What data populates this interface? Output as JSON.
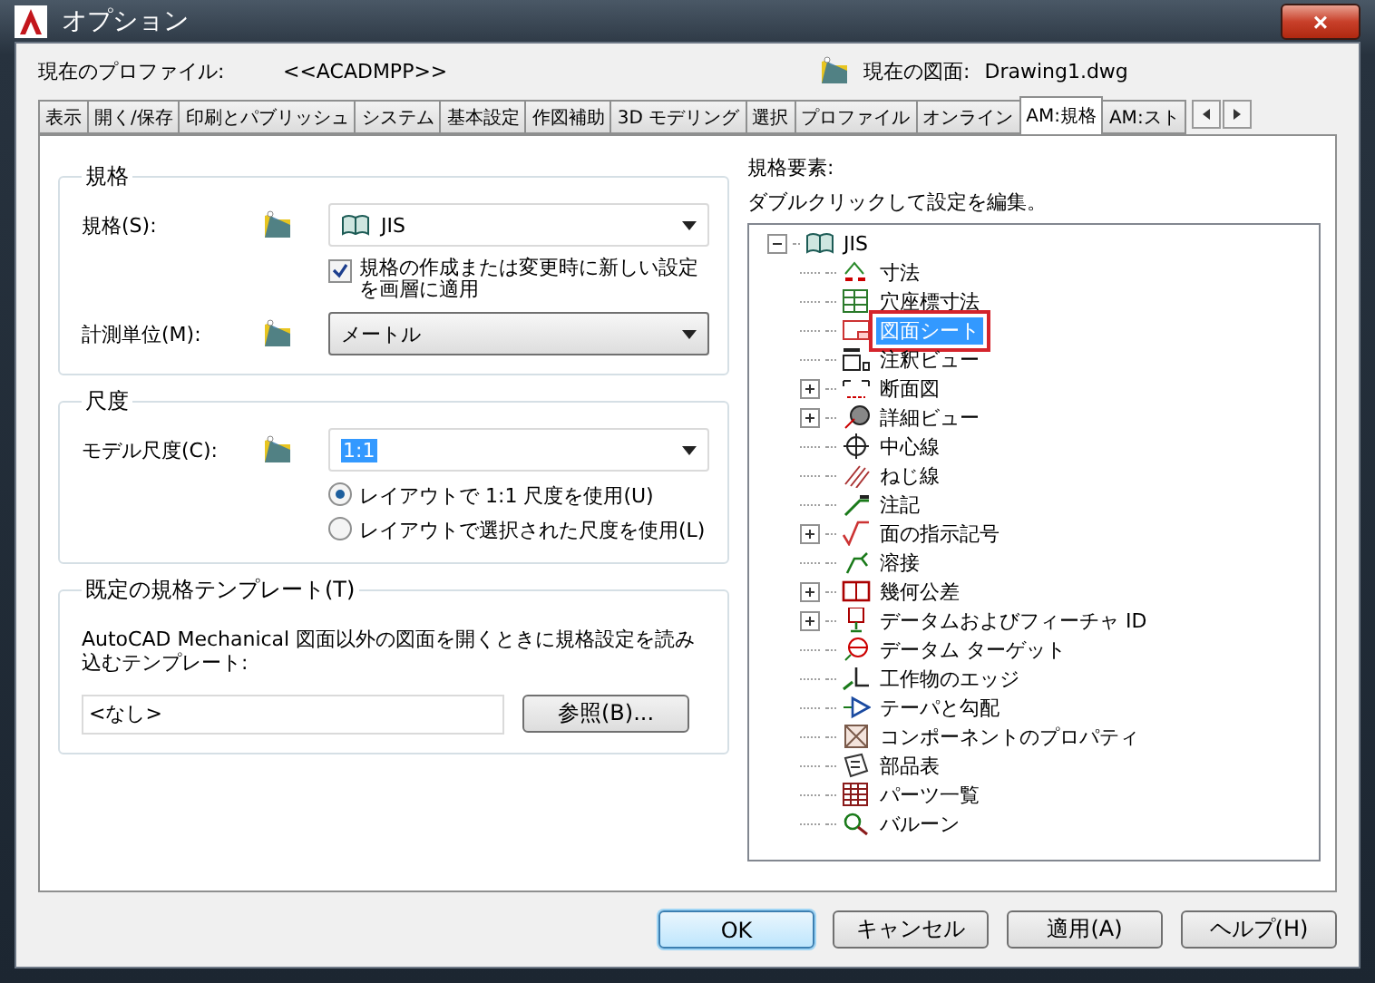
{
  "window": {
    "title": "オプション",
    "close": "×"
  },
  "profile": {
    "label": "現在のプロファイル:",
    "value": "<<ACADMPP>>",
    "drawing_label": "現在の図面:",
    "drawing_value": "Drawing1.dwg"
  },
  "tabs": [
    {
      "label": "表示",
      "selected": false
    },
    {
      "label": "開く/保存",
      "selected": false
    },
    {
      "label": "印刷とパブリッシュ",
      "selected": false
    },
    {
      "label": "システム",
      "selected": false
    },
    {
      "label": "基本設定",
      "selected": false
    },
    {
      "label": "作図補助",
      "selected": false
    },
    {
      "label": "3D モデリング",
      "selected": false
    },
    {
      "label": "選択",
      "selected": false
    },
    {
      "label": "プロファイル",
      "selected": false
    },
    {
      "label": "オンライン",
      "selected": false
    },
    {
      "label": "AM:規格",
      "selected": true
    },
    {
      "label": "AM:スト",
      "selected": false
    }
  ],
  "standard_group": {
    "title": "規格",
    "standard_label": "規格(S):",
    "standard_value": "JIS",
    "checkbox": {
      "label": "規格の作成または変更時に新しい設定を画層に適用",
      "checked": true
    },
    "unit_label": "計測単位(M):",
    "unit_value": "メートル"
  },
  "scale_group": {
    "title": "尺度",
    "model_scale_label": "モデル尺度(C):",
    "model_scale_value": "1:1",
    "value_highlighted": true,
    "radios": [
      {
        "label": "レイアウトで 1:1 尺度を使用(U)",
        "selected": true
      },
      {
        "label": "レイアウトで選択された尺度を使用(L)",
        "selected": false
      }
    ]
  },
  "template_group": {
    "title": "既定の規格テンプレート(T)",
    "description": "AutoCAD Mechanical 図面以外の図面を開くときに規格設定を読み込むテンプレート:",
    "value": "<なし>",
    "browse_button": "参照(B)..."
  },
  "elements": {
    "title": "規格要素:",
    "hint": "ダブルクリックして設定を編集。",
    "tree": {
      "label": "JIS",
      "expanded": true,
      "children": [
        {
          "label": "寸法",
          "expandable": false,
          "selected": false
        },
        {
          "label": "穴座標寸法",
          "expandable": false,
          "selected": false
        },
        {
          "label": "図面シート",
          "expandable": false,
          "selected": true
        },
        {
          "label": "注釈ビュー",
          "expandable": false,
          "selected": false
        },
        {
          "label": "断面図",
          "expandable": true,
          "selected": false
        },
        {
          "label": "詳細ビュー",
          "expandable": true,
          "selected": false
        },
        {
          "label": "中心線",
          "expandable": false,
          "selected": false
        },
        {
          "label": "ねじ線",
          "expandable": false,
          "selected": false
        },
        {
          "label": "注記",
          "expandable": false,
          "selected": false
        },
        {
          "label": "面の指示記号",
          "expandable": true,
          "selected": false
        },
        {
          "label": "溶接",
          "expandable": false,
          "selected": false
        },
        {
          "label": "幾何公差",
          "expandable": true,
          "selected": false
        },
        {
          "label": "データムおよびフィーチャ ID",
          "expandable": true,
          "selected": false
        },
        {
          "label": "データム ターゲット",
          "expandable": false,
          "selected": false
        },
        {
          "label": "工作物のエッジ",
          "expandable": false,
          "selected": false
        },
        {
          "label": "テーパと勾配",
          "expandable": false,
          "selected": false
        },
        {
          "label": "コンポーネントのプロパティ",
          "expandable": false,
          "selected": false
        },
        {
          "label": "部品表",
          "expandable": false,
          "selected": false
        },
        {
          "label": "パーツ一覧",
          "expandable": false,
          "selected": false
        },
        {
          "label": "バルーン",
          "expandable": false,
          "selected": false
        }
      ]
    }
  },
  "buttons": [
    {
      "label": "OK",
      "default": true
    },
    {
      "label": "キャンセル",
      "default": false
    },
    {
      "label": "適用(A)",
      "default": false
    },
    {
      "label": "ヘルプ(H)",
      "default": false
    }
  ]
}
